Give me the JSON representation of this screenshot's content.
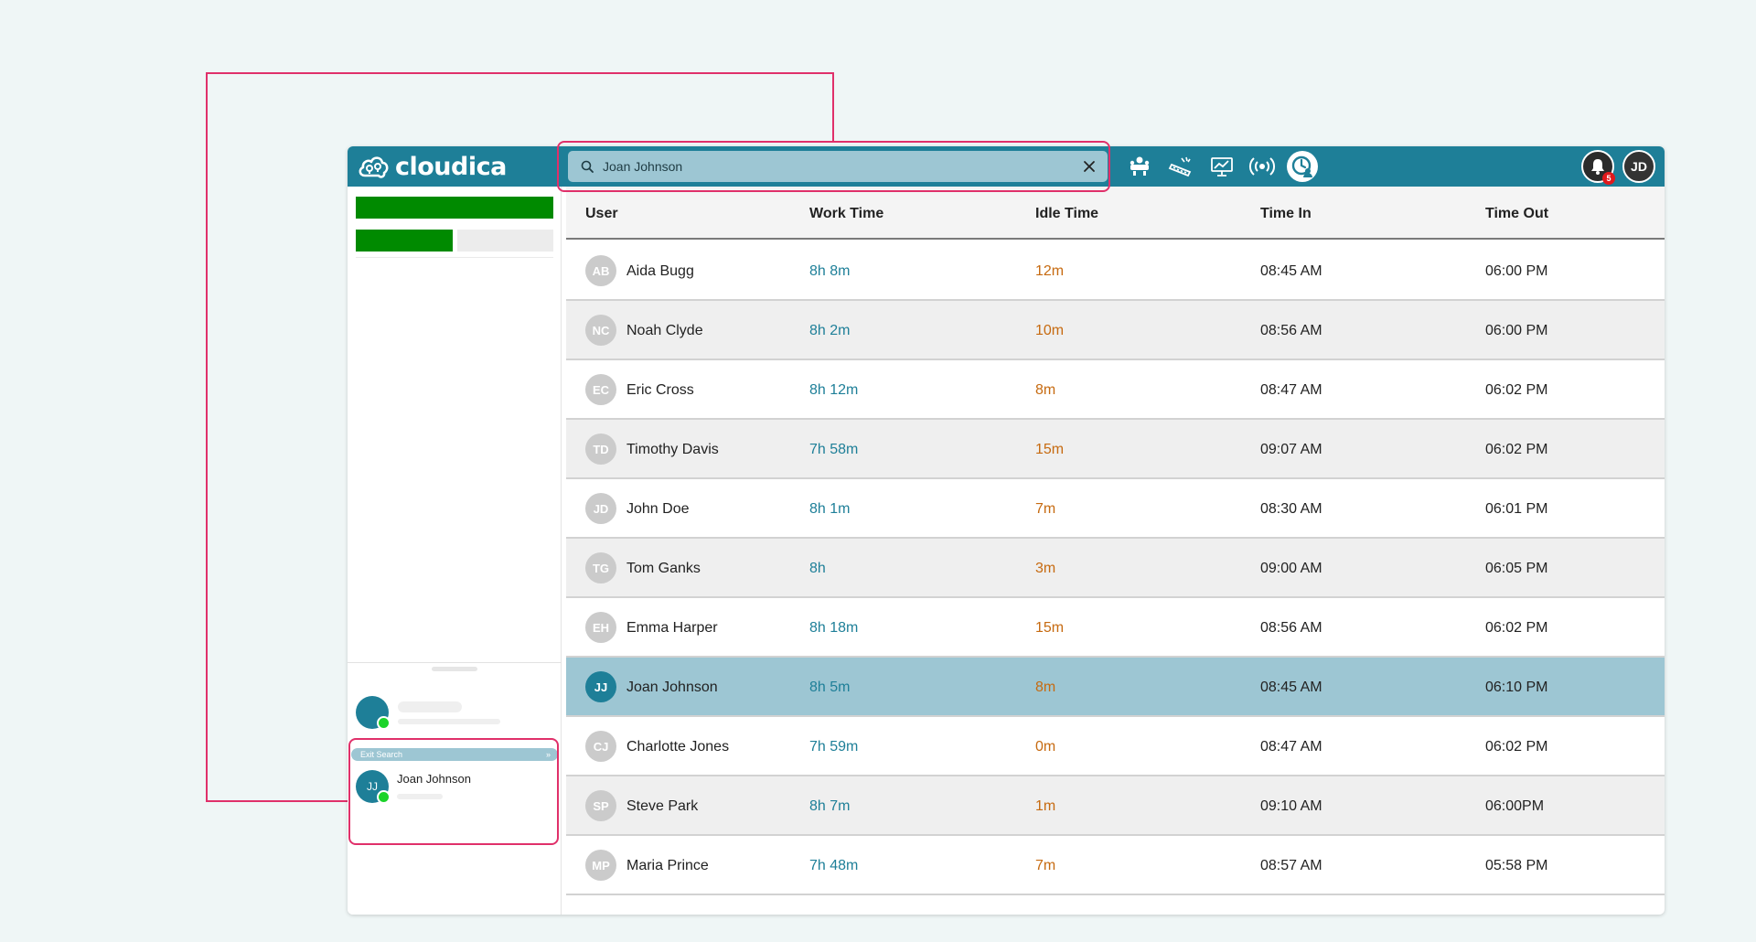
{
  "app": {
    "logo_text": "cloudica",
    "search": {
      "value": "Joan Johnson",
      "placeholder": ""
    },
    "notifications": {
      "count": "5"
    },
    "current_user_initials": "JD",
    "toolbar_icons": [
      "conference-icon",
      "keyboard-icon",
      "monitor-chart-icon",
      "broadcast-icon",
      "clock-user-icon"
    ]
  },
  "sidebar": {
    "exit_search_label": "Exit Search",
    "exit_search_arrow": "»",
    "search_result": {
      "initials": "JJ",
      "name": "Joan Johnson"
    }
  },
  "table": {
    "headers": {
      "user": "User",
      "work": "Work Time",
      "idle": "Idle Time",
      "time_in": "Time In",
      "time_out": "Time Out"
    },
    "rows": [
      {
        "initials": "AB",
        "name": "Aida Bugg",
        "work": "8h 8m",
        "idle": "12m",
        "time_in": "08:45 AM",
        "time_out": "06:00 PM"
      },
      {
        "initials": "NC",
        "name": "Noah Clyde",
        "work": "8h 2m",
        "idle": "10m",
        "time_in": "08:56 AM",
        "time_out": "06:00 PM"
      },
      {
        "initials": "EC",
        "name": "Eric Cross",
        "work": "8h 12m",
        "idle": "8m",
        "time_in": "08:47 AM",
        "time_out": "06:02 PM"
      },
      {
        "initials": "TD",
        "name": "Timothy Davis",
        "work": "7h 58m",
        "idle": "15m",
        "time_in": "09:07 AM",
        "time_out": "06:02 PM"
      },
      {
        "initials": "JD",
        "name": "John Doe",
        "work": "8h 1m",
        "idle": "7m",
        "time_in": "08:30 AM",
        "time_out": "06:01 PM"
      },
      {
        "initials": "TG",
        "name": "Tom Ganks",
        "work": "8h",
        "idle": "3m",
        "time_in": "09:00 AM",
        "time_out": "06:05 PM"
      },
      {
        "initials": "EH",
        "name": "Emma Harper",
        "work": "8h 18m",
        "idle": "15m",
        "time_in": "08:56 AM",
        "time_out": "06:02 PM"
      },
      {
        "initials": "JJ",
        "name": "Joan Johnson",
        "work": "8h 5m",
        "idle": "8m",
        "time_in": "08:45 AM",
        "time_out": "06:10 PM",
        "selected": true
      },
      {
        "initials": "CJ",
        "name": "Charlotte Jones",
        "work": "7h 59m",
        "idle": "0m",
        "time_in": "08:47 AM",
        "time_out": "06:02 PM"
      },
      {
        "initials": "SP",
        "name": "Steve Park",
        "work": "8h 7m",
        "idle": "1m",
        "time_in": "09:10 AM",
        "time_out": "06:00PM"
      },
      {
        "initials": "MP",
        "name": "Maria Prince",
        "work": "7h 48m",
        "idle": "7m",
        "time_in": "08:57 AM",
        "time_out": "05:58 PM"
      }
    ]
  },
  "colors": {
    "brand": "#1e7f98",
    "highlight": "#9dc6d3",
    "progress": "#008a00",
    "idle_text": "#c66a10",
    "annotation": "#e0306a",
    "online": "#1bd32a"
  }
}
